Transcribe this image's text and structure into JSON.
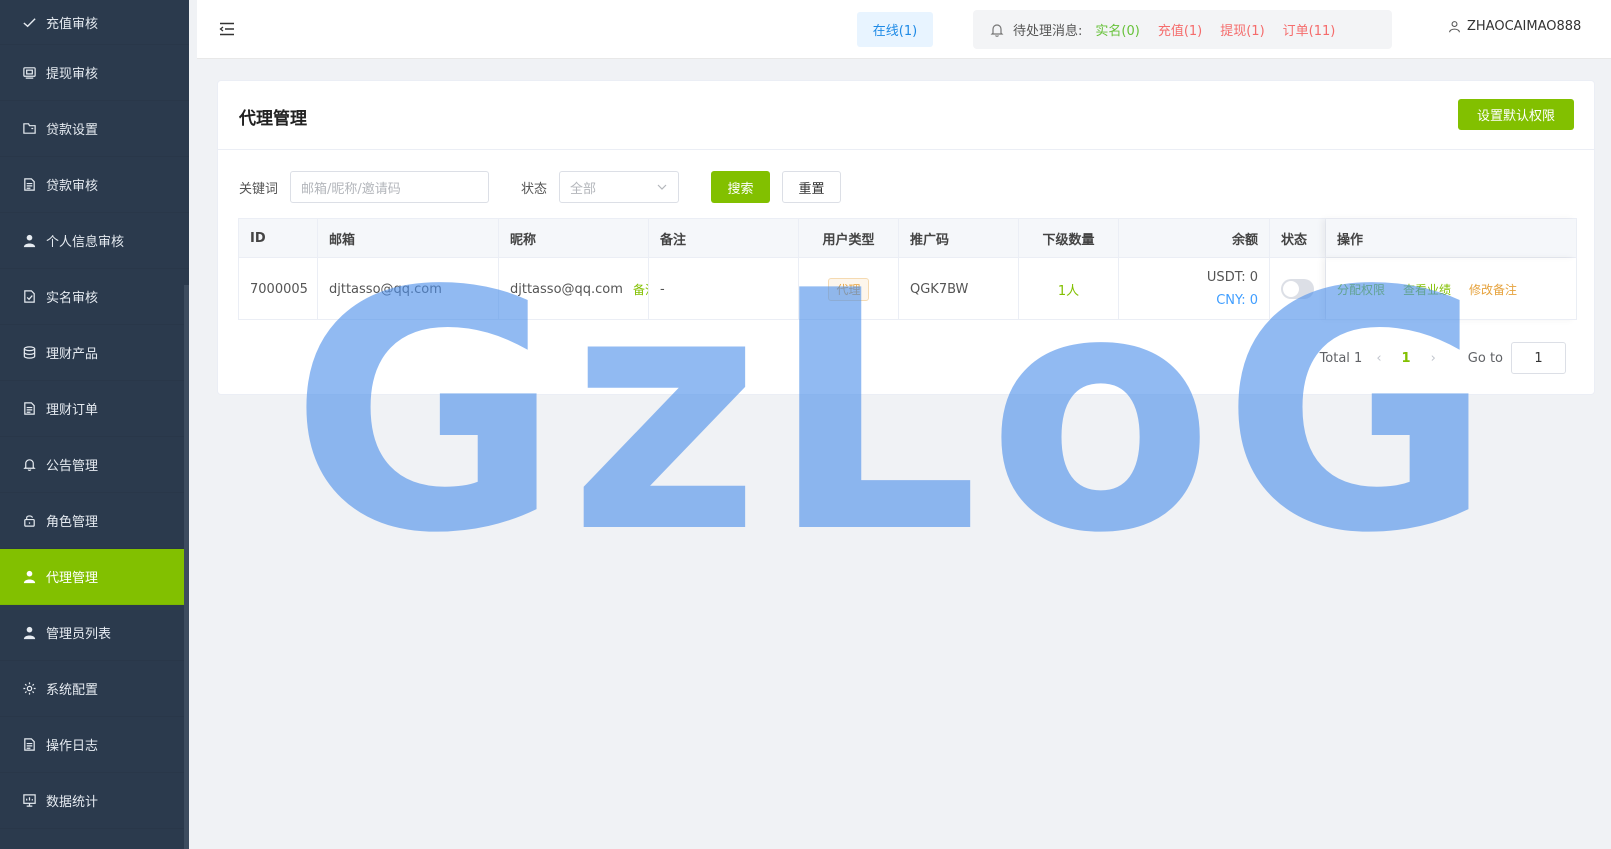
{
  "sidebar": {
    "items": [
      {
        "label": "充值审核",
        "icon": "check-icon",
        "active": false
      },
      {
        "label": "提现审核",
        "icon": "withdraw-icon",
        "active": false
      },
      {
        "label": "贷款设置",
        "icon": "folder-icon",
        "active": false
      },
      {
        "label": "贷款审核",
        "icon": "document-icon",
        "active": false
      },
      {
        "label": "个人信息审核",
        "icon": "user-icon",
        "active": false
      },
      {
        "label": "实名审核",
        "icon": "document-check-icon",
        "active": false
      },
      {
        "label": "理财产品",
        "icon": "database-icon",
        "active": false
      },
      {
        "label": "理财订单",
        "icon": "document-icon",
        "active": false
      },
      {
        "label": "公告管理",
        "icon": "bell-icon",
        "active": false
      },
      {
        "label": "角色管理",
        "icon": "lock-icon",
        "active": false
      },
      {
        "label": "代理管理",
        "icon": "user-icon",
        "active": true
      },
      {
        "label": "管理员列表",
        "icon": "user-icon",
        "active": false
      },
      {
        "label": "系统配置",
        "icon": "gear-icon",
        "active": false
      },
      {
        "label": "操作日志",
        "icon": "document-icon",
        "active": false
      },
      {
        "label": "数据统计",
        "icon": "chart-icon",
        "active": false
      }
    ]
  },
  "header": {
    "online": "在线(1)",
    "pending_label": "待处理消息:",
    "pending": {
      "realname": "实名(0)",
      "recharge": "充值(1)",
      "withdraw": "提现(1)",
      "order": "订单(11)"
    },
    "username": "ZHAOCAIMAO888",
    "colors": {
      "green": "#67c23a",
      "red": "#f56c6c",
      "online_blue": "#1e8ae6",
      "accent": "#82c000"
    }
  },
  "page": {
    "title": "代理管理",
    "default_perm_button": "设置默认权限"
  },
  "filter": {
    "keyword_label": "关键词",
    "keyword_placeholder": "邮箱/昵称/邀请码",
    "status_label": "状态",
    "status_value": "全部",
    "search_button": "搜索",
    "reset_button": "重置"
  },
  "table": {
    "columns": {
      "id": "ID",
      "email": "邮箱",
      "nickname": "昵称",
      "note": "备注",
      "user_type": "用户类型",
      "promo_code": "推广码",
      "sub_count": "下级数量",
      "balance": "余额",
      "status": "状态",
      "ops": "操作"
    },
    "rows": [
      {
        "id": "7000005",
        "email": "djttasso@qq.com",
        "nickname": "djttasso@qq.com",
        "nickname_tag": "备注",
        "note": "-",
        "user_type": "代理",
        "promo_code": "QGK7BW",
        "sub_count": "1人",
        "balance_usdt": "USDT: 0",
        "balance_cny": "CNY: 0",
        "status_on": false,
        "ops": {
          "assign": "分配权限",
          "performance": "查看业绩",
          "edit_note": "修改备注"
        }
      }
    ]
  },
  "pagination": {
    "total": "Total 1",
    "current": "1",
    "goto_label": "Go to",
    "goto_value": "1"
  },
  "watermark": "GzLoG"
}
